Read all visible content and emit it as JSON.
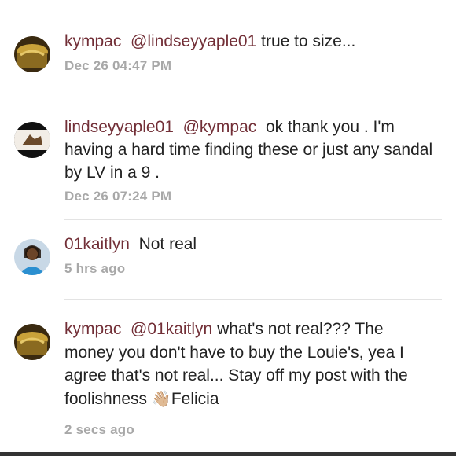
{
  "comments": [
    {
      "user": "kympac",
      "mention": "@lindseyyaple01",
      "body": "true to size...",
      "time": "Dec 26 04:47 PM"
    },
    {
      "user": "lindseyyaple01",
      "mention": "@kympac",
      "body": "ok thank you . I'm having a hard time finding these or just any sandal by LV in a 9 .",
      "time": "Dec 26 07:24 PM"
    },
    {
      "user": "01kaitlyn",
      "mention": "",
      "body": "Not real",
      "time": "5 hrs ago"
    },
    {
      "user": "kympac",
      "mention": "@01kaitlyn",
      "body": "what's not real??? The money you don't have to buy the Louie's, yea I agree that's not real... Stay off my post with the foolishness",
      "emoji": "👋🏼",
      "body_end": "Felicia",
      "time": "2 secs ago"
    }
  ],
  "colors": {
    "username": "#722f37",
    "time": "#a8a8a8",
    "text": "#222222"
  },
  "icons": [
    "avatar-gold-bag",
    "avatar-sandals",
    "avatar-person",
    "avatar-gold-bag"
  ]
}
